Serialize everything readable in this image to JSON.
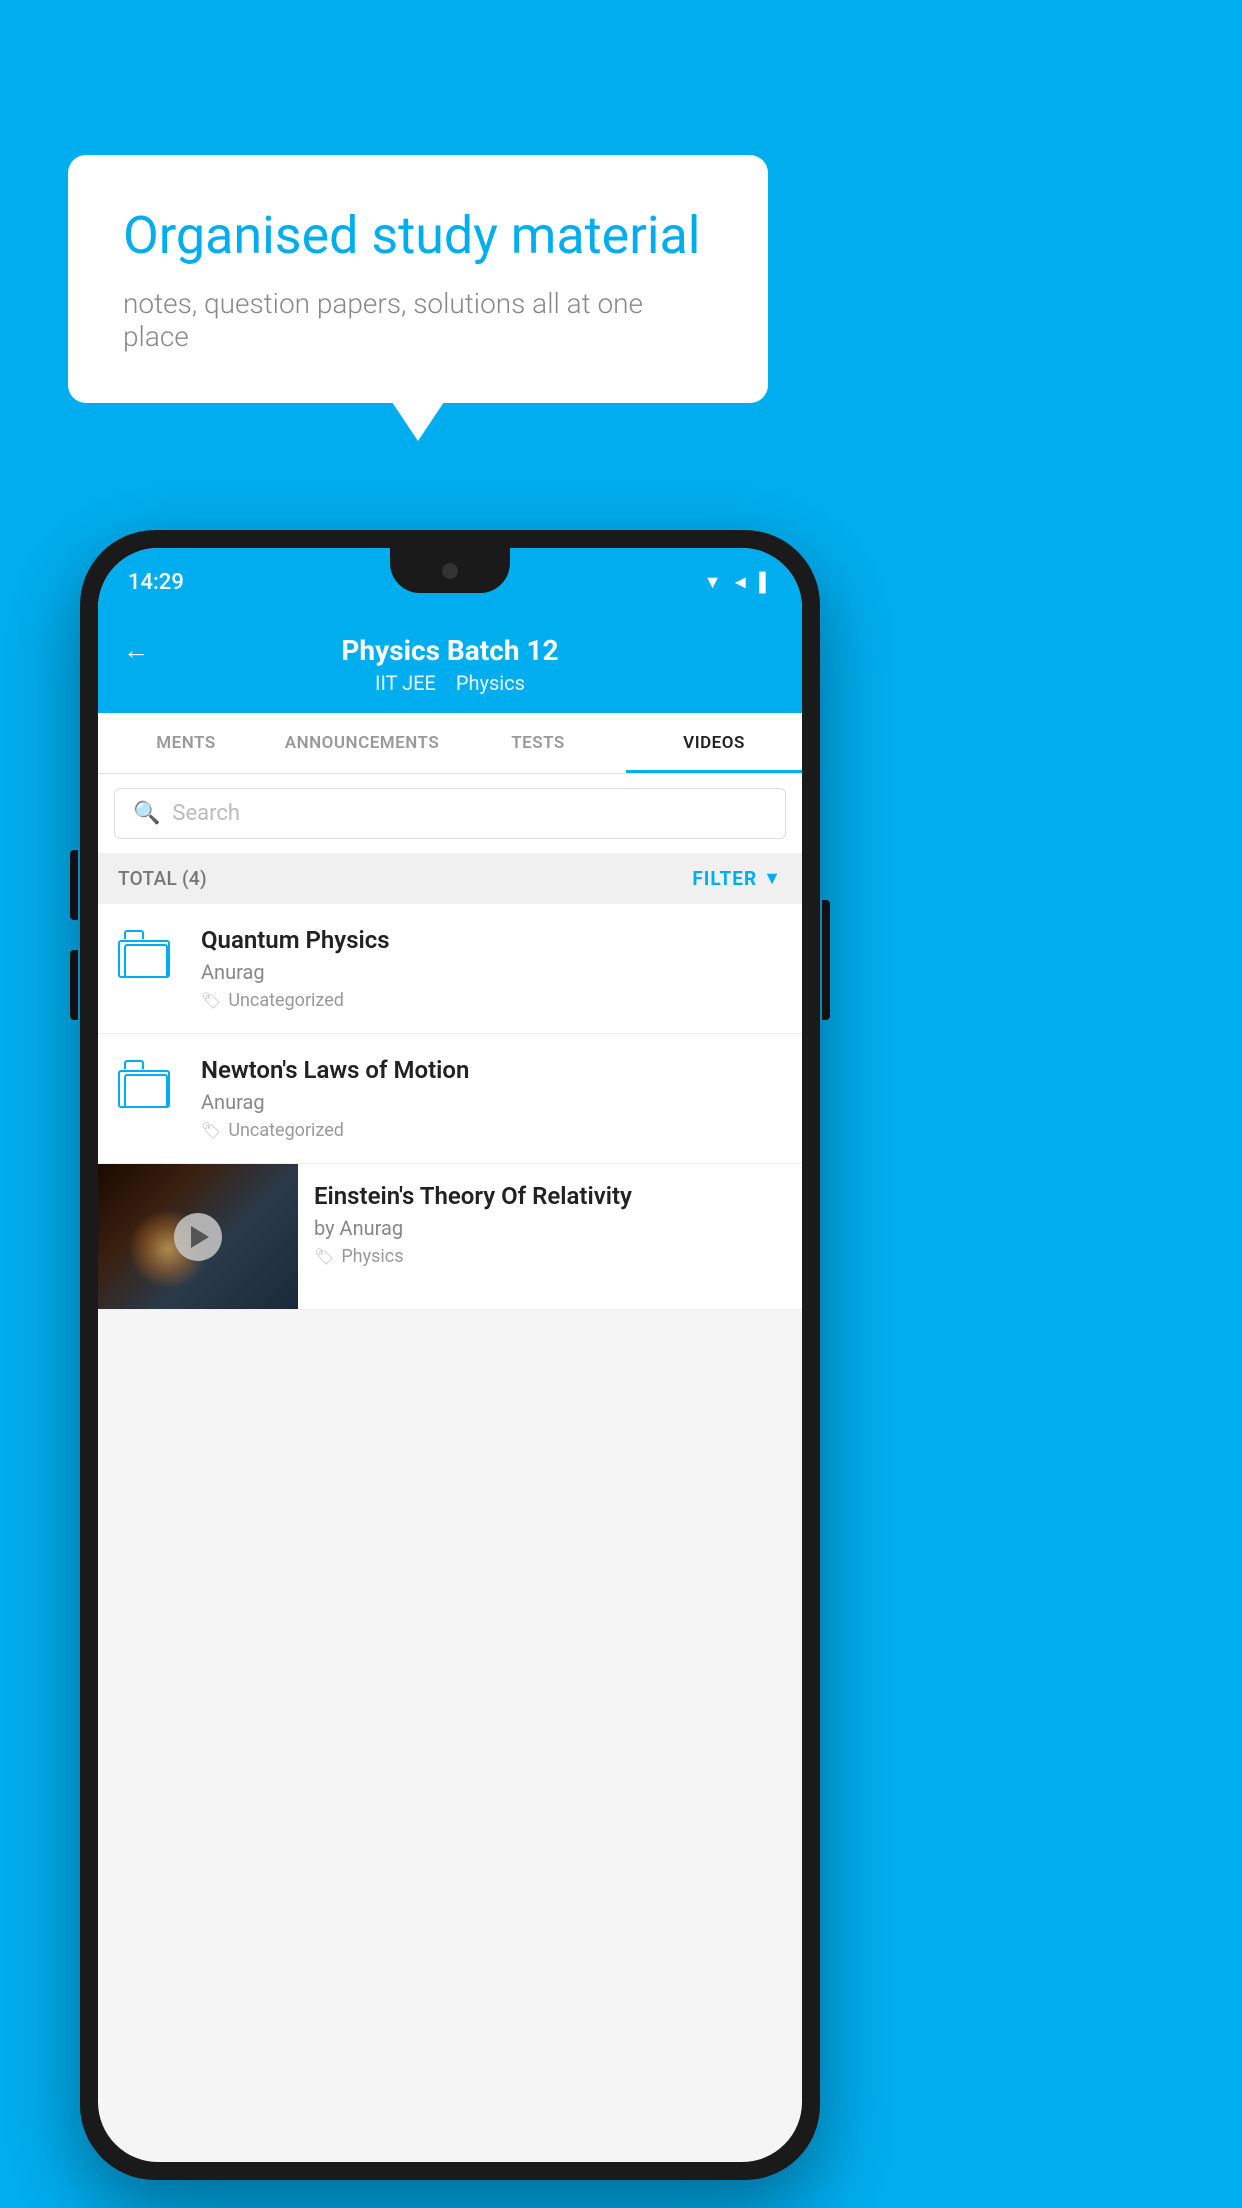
{
  "background_color": "#00AEEF",
  "bubble": {
    "title": "Organised study material",
    "subtitle": "notes, question papers, solutions all at one place"
  },
  "phone": {
    "status_bar": {
      "time": "14:29",
      "icons": "▼◄▌"
    },
    "header": {
      "back_label": "←",
      "title": "Physics Batch 12",
      "subtitle1": "IIT JEE",
      "subtitle2": "Physics"
    },
    "tabs": [
      {
        "label": "MENTS",
        "active": false
      },
      {
        "label": "ANNOUNCEMENTS",
        "active": false
      },
      {
        "label": "TESTS",
        "active": false
      },
      {
        "label": "VIDEOS",
        "active": true
      }
    ],
    "search": {
      "placeholder": "Search"
    },
    "filter_bar": {
      "total_label": "TOTAL (4)",
      "filter_label": "FILTER"
    },
    "videos": [
      {
        "type": "folder",
        "title": "Quantum Physics",
        "author": "Anurag",
        "tag": "Uncategorized",
        "has_thumbnail": false
      },
      {
        "type": "folder",
        "title": "Newton's Laws of Motion",
        "author": "Anurag",
        "tag": "Uncategorized",
        "has_thumbnail": false
      },
      {
        "type": "video",
        "title": "Einstein's Theory Of Relativity",
        "author": "by Anurag",
        "tag": "Physics",
        "has_thumbnail": true
      }
    ]
  }
}
